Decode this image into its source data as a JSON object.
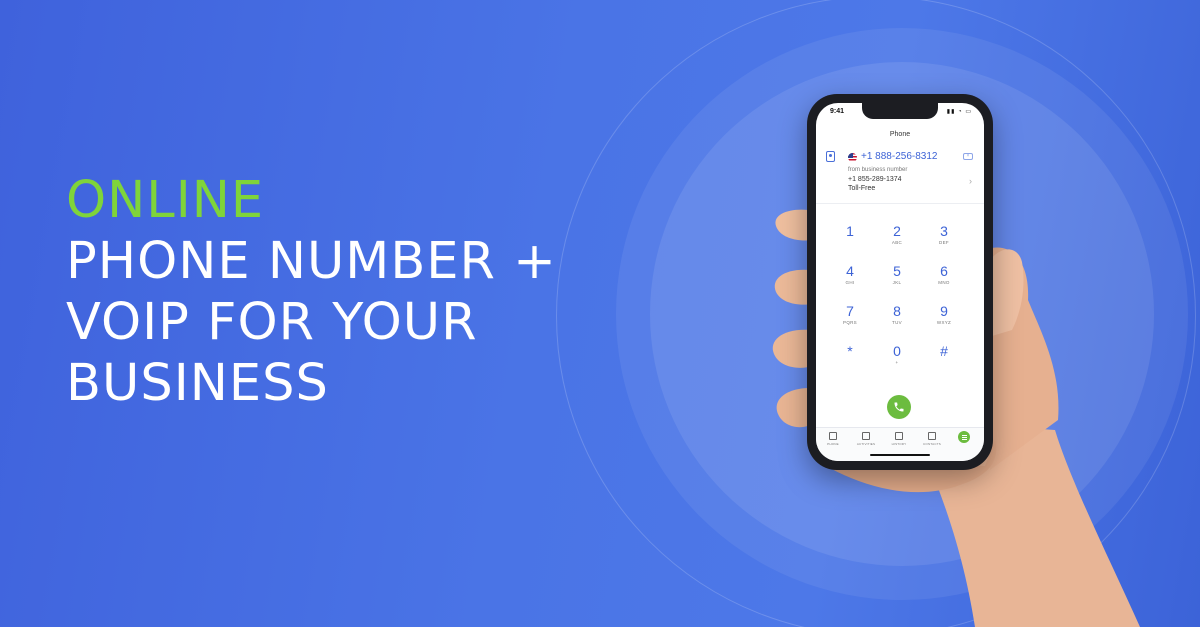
{
  "headline": {
    "accent": "ONLINE",
    "line1": "PHONE NUMBER +",
    "line2": "VOIP FOR YOUR",
    "line3": "BUSINESS"
  },
  "colors": {
    "background": "#4a74e6",
    "accent_green": "#7fd43a",
    "link_blue": "#3d63d6",
    "call_green": "#6cbc3f"
  },
  "phone": {
    "status": {
      "time": "9:41",
      "icons": "signal-wifi-battery"
    },
    "app_title": "Phone",
    "dial": {
      "number": "+1 888-256-8312",
      "from_label": "from business number",
      "from_number": "+1 855-289-1374",
      "from_type": "Toll-Free"
    },
    "keypad": [
      {
        "digit": "1",
        "letters": ""
      },
      {
        "digit": "2",
        "letters": "ABC"
      },
      {
        "digit": "3",
        "letters": "DEF"
      },
      {
        "digit": "4",
        "letters": "GHI"
      },
      {
        "digit": "5",
        "letters": "JKL"
      },
      {
        "digit": "6",
        "letters": "MNO"
      },
      {
        "digit": "7",
        "letters": "PQRS"
      },
      {
        "digit": "8",
        "letters": "TUV"
      },
      {
        "digit": "9",
        "letters": "WXYZ"
      },
      {
        "digit": "*",
        "letters": ""
      },
      {
        "digit": "0",
        "letters": "+"
      },
      {
        "digit": "#",
        "letters": ""
      }
    ],
    "tabs": [
      {
        "label": "PHONE",
        "icon": "keypad-icon"
      },
      {
        "label": "ACTIVITIES",
        "icon": "star-icon"
      },
      {
        "label": "HISTORY",
        "icon": "history-icon"
      },
      {
        "label": "CONTACTS",
        "icon": "contacts-icon"
      }
    ]
  }
}
